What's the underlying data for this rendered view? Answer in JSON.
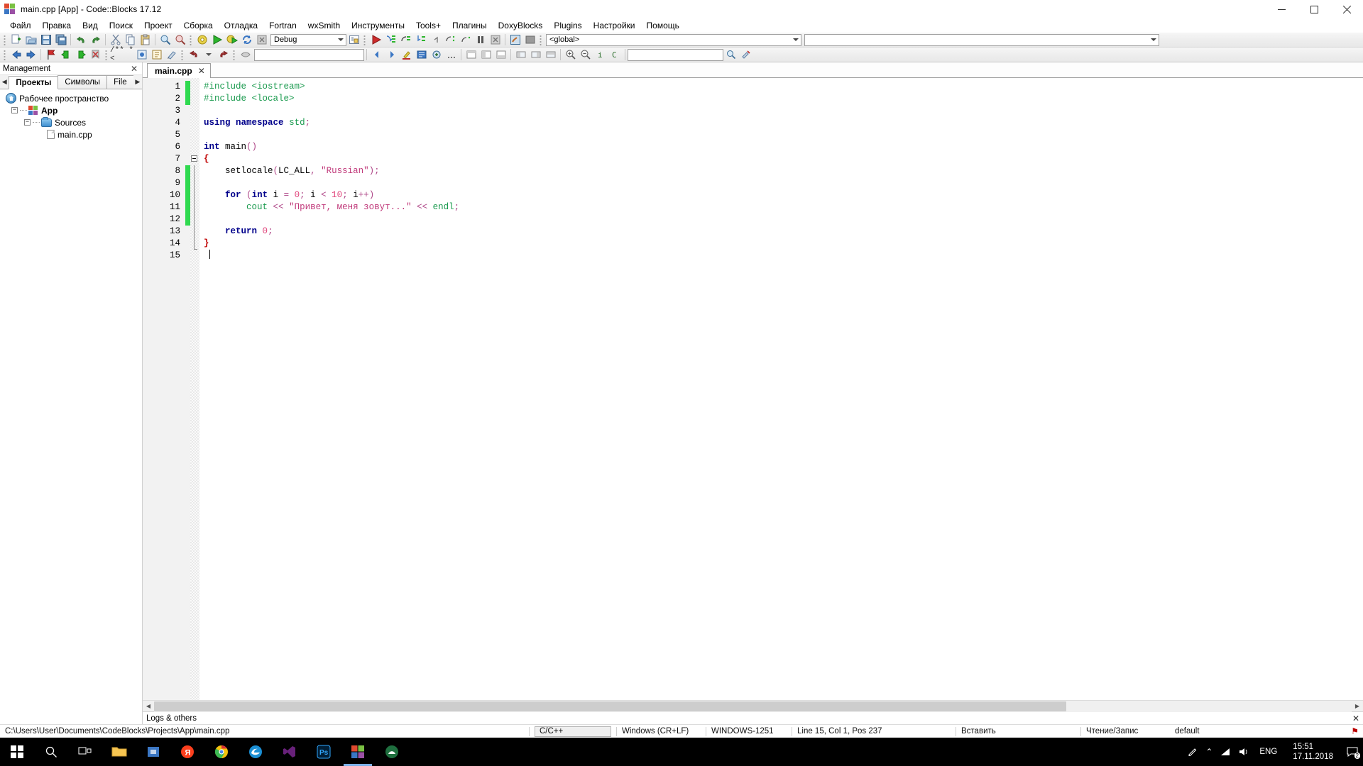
{
  "window": {
    "title": "main.cpp [App] - Code::Blocks 17.12",
    "icon": "codeblocks-logo-icon",
    "minimize_label": "─",
    "maximize_label": "☐",
    "close_label": "✕"
  },
  "menubar": {
    "items": [
      {
        "label": "Файл"
      },
      {
        "label": "Правка"
      },
      {
        "label": "Вид"
      },
      {
        "label": "Поиск"
      },
      {
        "label": "Проект"
      },
      {
        "label": "Сборка"
      },
      {
        "label": "Отладка"
      },
      {
        "label": "Fortran"
      },
      {
        "label": "wxSmith"
      },
      {
        "label": "Инструменты"
      },
      {
        "label": "Tools+"
      },
      {
        "label": "Плагины"
      },
      {
        "label": "DoxyBlocks"
      },
      {
        "label": "Plugins"
      },
      {
        "label": "Настройки"
      },
      {
        "label": "Помощь"
      }
    ]
  },
  "toolbar": {
    "build_target": "Debug",
    "scope": "<global>",
    "find_value": "",
    "doxy_value": "/** *<",
    "jump_value": "",
    "search_value": ""
  },
  "management": {
    "title": "Management",
    "close_label": "✕",
    "tabs": [
      {
        "label": "Проекты",
        "active": true
      },
      {
        "label": "Символы",
        "active": false
      },
      {
        "label": "File",
        "active": false
      }
    ],
    "scroll_left_label": "◀",
    "scroll_right_label": "▶",
    "tree": {
      "workspace": "Рабочее пространство",
      "project": "App",
      "folder": "Sources",
      "file": "main.cpp"
    }
  },
  "editor": {
    "tabs": [
      {
        "label": "main.cpp",
        "close_label": "✕",
        "active": true
      }
    ],
    "line_numbers": [
      "1",
      "2",
      "3",
      "4",
      "5",
      "6",
      "7",
      "8",
      "9",
      "10",
      "11",
      "12",
      "13",
      "14",
      "15"
    ],
    "modified_lines": [
      1,
      2,
      8,
      9,
      10,
      11,
      12
    ],
    "lines": [
      {
        "n": 1,
        "tokens": [
          {
            "t": "pre",
            "v": "#include <iostream>"
          }
        ]
      },
      {
        "n": 2,
        "tokens": [
          {
            "t": "pre",
            "v": "#include <locale>"
          }
        ]
      },
      {
        "n": 3,
        "tokens": []
      },
      {
        "n": 4,
        "tokens": [
          {
            "t": "kw",
            "v": "using"
          },
          {
            "t": "txt",
            "v": " "
          },
          {
            "t": "kw",
            "v": "namespace"
          },
          {
            "t": "txt",
            "v": " "
          },
          {
            "t": "pre",
            "v": "std"
          },
          {
            "t": "op",
            "v": ";"
          }
        ]
      },
      {
        "n": 5,
        "tokens": []
      },
      {
        "n": 6,
        "tokens": [
          {
            "t": "kw",
            "v": "int"
          },
          {
            "t": "txt",
            "v": " "
          },
          {
            "t": "id",
            "v": "main"
          },
          {
            "t": "op",
            "v": "()"
          }
        ]
      },
      {
        "n": 7,
        "tokens": [
          {
            "t": "brace",
            "v": "{"
          }
        ]
      },
      {
        "n": 8,
        "tokens": [
          {
            "t": "txt",
            "v": "    "
          },
          {
            "t": "id",
            "v": "setlocale"
          },
          {
            "t": "op",
            "v": "("
          },
          {
            "t": "id",
            "v": "LC_ALL"
          },
          {
            "t": "op",
            "v": ", "
          },
          {
            "t": "str",
            "v": "\"Russian\""
          },
          {
            "t": "op",
            "v": ");"
          }
        ]
      },
      {
        "n": 9,
        "tokens": []
      },
      {
        "n": 10,
        "tokens": [
          {
            "t": "txt",
            "v": "    "
          },
          {
            "t": "kw",
            "v": "for"
          },
          {
            "t": "txt",
            "v": " "
          },
          {
            "t": "op",
            "v": "("
          },
          {
            "t": "kw",
            "v": "int"
          },
          {
            "t": "txt",
            "v": " i "
          },
          {
            "t": "op",
            "v": "= "
          },
          {
            "t": "num",
            "v": "0"
          },
          {
            "t": "op",
            "v": ";"
          },
          {
            "t": "txt",
            "v": " i "
          },
          {
            "t": "op",
            "v": "< "
          },
          {
            "t": "num",
            "v": "10"
          },
          {
            "t": "op",
            "v": ";"
          },
          {
            "t": "txt",
            "v": " i"
          },
          {
            "t": "op",
            "v": "++)"
          }
        ]
      },
      {
        "n": 11,
        "tokens": [
          {
            "t": "txt",
            "v": "        "
          },
          {
            "t": "pre",
            "v": "cout"
          },
          {
            "t": "txt",
            "v": " "
          },
          {
            "t": "op",
            "v": "<< "
          },
          {
            "t": "str",
            "v": "\"Привет, меня зовут...\""
          },
          {
            "t": "txt",
            "v": " "
          },
          {
            "t": "op",
            "v": "<< "
          },
          {
            "t": "pre",
            "v": "endl"
          },
          {
            "t": "op",
            "v": ";"
          }
        ]
      },
      {
        "n": 12,
        "tokens": []
      },
      {
        "n": 13,
        "tokens": [
          {
            "t": "txt",
            "v": "    "
          },
          {
            "t": "kw",
            "v": "return"
          },
          {
            "t": "txt",
            "v": " "
          },
          {
            "t": "num",
            "v": "0"
          },
          {
            "t": "op",
            "v": ";"
          }
        ]
      },
      {
        "n": 14,
        "tokens": [
          {
            "t": "brace",
            "v": "}"
          }
        ]
      },
      {
        "n": 15,
        "tokens": []
      }
    ]
  },
  "logs": {
    "title": "Logs & others",
    "close_label": "✕"
  },
  "statusbar": {
    "path": "C:\\Users\\User\\Documents\\CodeBlocks\\Projects\\App\\main.cpp",
    "language": "C/C++",
    "eol": "Windows (CR+LF)",
    "encoding": "WINDOWS-1251",
    "position": "Line 15, Col 1, Pos 237",
    "insert_mode": "Вставить",
    "read_write": "Чтение/Запис",
    "profile": "default",
    "flag_icon": "flag-icon"
  },
  "taskbar": {
    "start_label": "start-button",
    "items": [
      {
        "name": "search-icon",
        "glyph": "⚲",
        "active": false
      },
      {
        "name": "task-view-icon",
        "glyph": "❐",
        "active": false
      },
      {
        "name": "file-explorer-icon",
        "glyph": "▭",
        "active": false
      },
      {
        "name": "store-icon",
        "glyph": "▣",
        "active": false
      },
      {
        "name": "yandex-browser-icon",
        "glyph": "Y",
        "active": false
      },
      {
        "name": "chrome-icon",
        "glyph": "◎",
        "active": false
      },
      {
        "name": "edge-icon",
        "glyph": "e",
        "active": false
      },
      {
        "name": "visual-studio-icon",
        "glyph": "∞",
        "active": false
      },
      {
        "name": "photoshop-icon",
        "glyph": "Ps",
        "active": false
      },
      {
        "name": "codeblocks-icon",
        "glyph": "▦",
        "active": true
      },
      {
        "name": "app-icon",
        "glyph": "◔",
        "active": false
      }
    ],
    "tray": {
      "pen_icon": "pen-icon",
      "chevron_up_icon": "⌃",
      "network_icon": "◤",
      "volume_icon": "◂",
      "language": "ENG",
      "time": "15:51",
      "date": "17.11.2018",
      "notification_icon": "notification-icon",
      "notification_count": "2"
    }
  }
}
